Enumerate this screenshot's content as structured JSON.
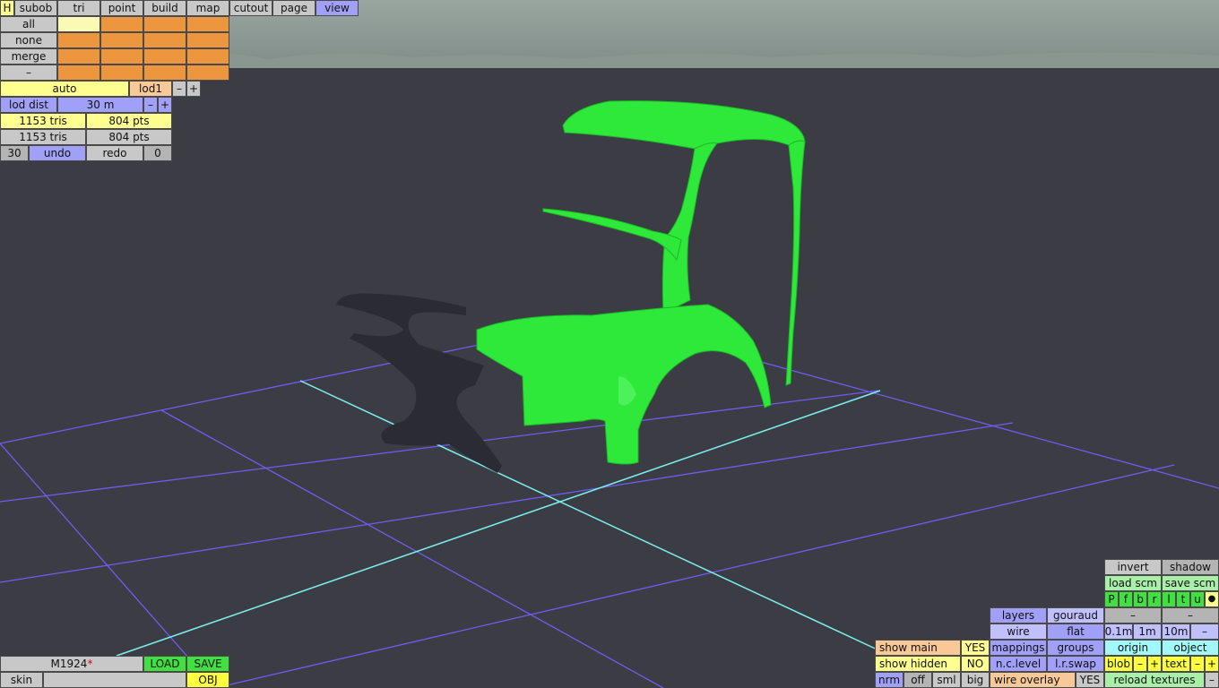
{
  "menu": {
    "h_label": "H",
    "tabs": [
      "subob",
      "tri",
      "point",
      "build",
      "map",
      "cutout",
      "page",
      "view"
    ],
    "active_tab": "view"
  },
  "selection": {
    "all": "all",
    "none": "none",
    "merge": "merge",
    "minus": "–"
  },
  "lod": {
    "mode": "auto",
    "level": "lod1",
    "minus": "–",
    "plus": "+",
    "dist_label": "lod dist",
    "dist_value": "30 m"
  },
  "stats": {
    "row1_tris": "1153 tris",
    "row1_pts": "804 pts",
    "row2_tris": "1153 tris",
    "row2_pts": "804 pts"
  },
  "history": {
    "count": "30",
    "undo": "undo",
    "redo": "redo",
    "index": "0"
  },
  "file": {
    "name": "M1924",
    "modified_mark": "*",
    "load": "LOAD",
    "save": "SAVE",
    "skin_label": "skin",
    "skin_value": "",
    "obj": "OBJ"
  },
  "view_panel": {
    "invert": "invert",
    "shadow": "shadow",
    "load_scm": "load scm",
    "save_scm": "save scm",
    "views": [
      "P",
      "f",
      "b",
      "r",
      "l",
      "t",
      "u"
    ],
    "dot": "●",
    "layers": "layers",
    "gouraud": "gouraud",
    "dash1": "–",
    "dash2": "–",
    "wire": "wire",
    "flat": "flat",
    "grid_01": "0.1m",
    "grid_1": "1m",
    "grid_10": "10m",
    "grid_minus": "–",
    "show_main": "show main",
    "show_main_val": "YES",
    "mappings": "mappings",
    "groups": "groups",
    "origin": "origin",
    "object": "object",
    "show_hidden": "show hidden",
    "show_hidden_val": "NO",
    "nc_level": "n.c.level",
    "lr_swap": "l.r.swap",
    "blob": "blob",
    "blob_minus": "–",
    "blob_plus": "+",
    "text": "text",
    "text_minus": "–",
    "text_plus": "+",
    "nrm": "nrm",
    "off": "off",
    "sml": "sml",
    "big": "big",
    "wire_overlay": "wire overlay",
    "wire_overlay_val": "YES",
    "reload_textures": "reload textures",
    "reload_minus": "–"
  },
  "colors": {
    "mesh": "#2ee83a",
    "grid": "#6e5cf0",
    "grid_axis": "#7cf0f0",
    "sky": "#8c9a94",
    "floor": "#3c3c44"
  }
}
